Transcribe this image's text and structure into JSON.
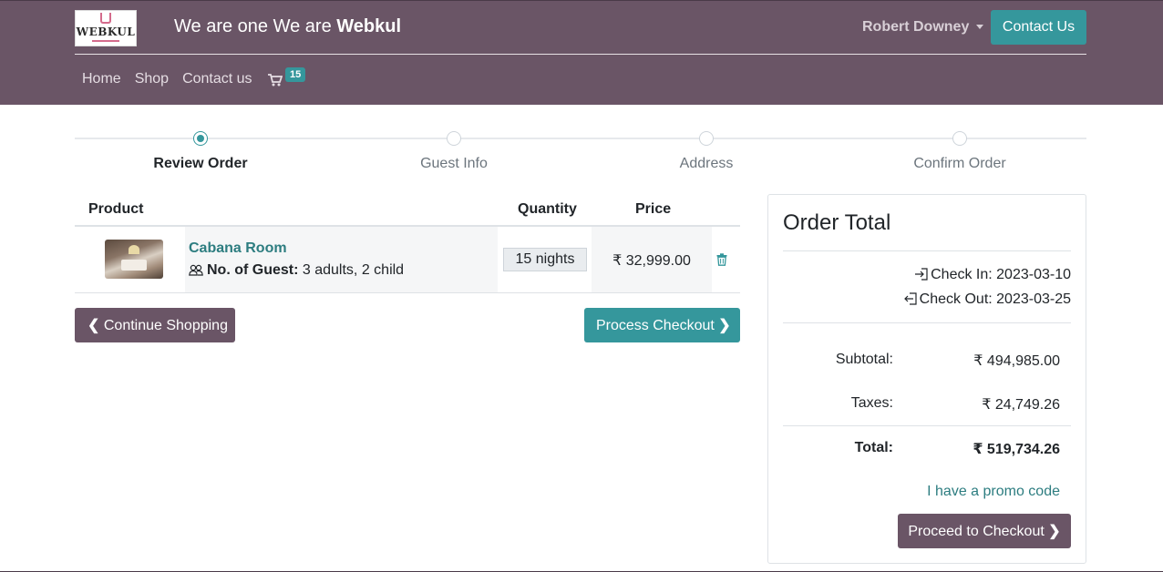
{
  "header": {
    "logo_text": "WEBKUL",
    "tagline_prefix": "We are one We are",
    "tagline_brand": "Webkul",
    "user_name": "Robert Downey",
    "contact_button": "Contact Us"
  },
  "nav": {
    "items": [
      "Home",
      "Shop",
      "Contact us"
    ],
    "cart_count": "15"
  },
  "steps": [
    {
      "label": "Review Order",
      "active": true
    },
    {
      "label": "Guest Info",
      "active": false
    },
    {
      "label": "Address",
      "active": false
    },
    {
      "label": "Confirm Order",
      "active": false
    }
  ],
  "table": {
    "headers": {
      "product": "Product",
      "quantity": "Quantity",
      "price": "Price"
    },
    "row": {
      "name": "Cabana Room",
      "guest_label": "No. of Guest:",
      "guest_value": "3 adults, 2 child",
      "quantity": "15 nights",
      "price": "₹ 32,999.00"
    }
  },
  "buttons": {
    "continue": "Continue Shopping",
    "process": "Process Checkout",
    "proceed": "Proceed to Checkout"
  },
  "order_total": {
    "title": "Order Total",
    "check_in": "Check In: 2023-03-10",
    "check_out": "Check Out: 2023-03-25",
    "subtotal_label": "Subtotal:",
    "subtotal_value": "₹ 494,985.00",
    "taxes_label": "Taxes:",
    "taxes_value": "₹ 24,749.26",
    "total_label": "Total:",
    "total_value": "₹ 519,734.26",
    "promo": "I have a promo code"
  },
  "colors": {
    "header": "#6a5566",
    "accent": "#35979c",
    "link": "#2d7d80"
  }
}
